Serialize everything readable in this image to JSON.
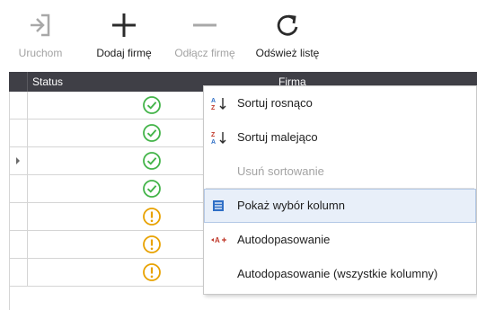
{
  "toolbar": {
    "buttons": [
      {
        "label": "Uruchom",
        "enabled": false,
        "icon": "launch-icon"
      },
      {
        "label": "Dodaj firmę",
        "enabled": true,
        "icon": "plus-icon"
      },
      {
        "label": "Odłącz firmę",
        "enabled": false,
        "icon": "minus-icon"
      },
      {
        "label": "Odśwież listę",
        "enabled": true,
        "icon": "refresh-icon"
      }
    ]
  },
  "grid": {
    "columns": [
      "Status",
      "Firma"
    ],
    "rows": [
      {
        "status": "ok",
        "current": false
      },
      {
        "status": "ok",
        "current": false
      },
      {
        "status": "ok",
        "current": true
      },
      {
        "status": "ok",
        "current": false
      },
      {
        "status": "warning",
        "current": false
      },
      {
        "status": "warning",
        "current": false
      },
      {
        "status": "warning",
        "current": false
      }
    ]
  },
  "context_menu": {
    "items": [
      {
        "label": "Sortuj rosnąco",
        "icon": "sort-ascending-icon",
        "enabled": true,
        "highlighted": false
      },
      {
        "label": "Sortuj malejąco",
        "icon": "sort-descending-icon",
        "enabled": true,
        "highlighted": false
      },
      {
        "label": "Usuń sortowanie",
        "icon": "",
        "enabled": false,
        "highlighted": false
      },
      {
        "label": "Pokaż wybór kolumn",
        "icon": "column-chooser-icon",
        "enabled": true,
        "highlighted": true
      },
      {
        "label": "Autodopasowanie",
        "icon": "autofit-icon",
        "enabled": true,
        "highlighted": false
      },
      {
        "label": "Autodopasowanie (wszystkie kolumny)",
        "icon": "",
        "enabled": true,
        "highlighted": false
      }
    ]
  },
  "colors": {
    "header_bg": "#3f3f46",
    "ok": "#43b449",
    "warning": "#e8a200",
    "disabled_text": "#a3a3a3",
    "highlight_bg": "#e8eff9"
  }
}
